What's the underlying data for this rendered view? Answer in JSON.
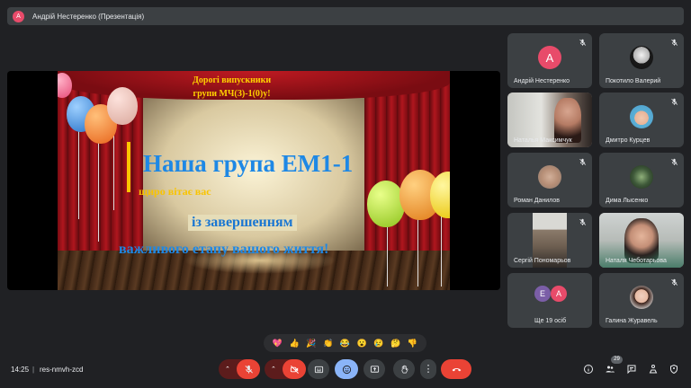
{
  "presenter": {
    "avatar_letter": "А",
    "title": "Андрій Нестеренко (Презентація)"
  },
  "slide": {
    "greeting_line1": "Дорогі випускники",
    "greeting_line2": "групи МЧ(З)-1(0)у!",
    "group_text": "Наша група ЕМ1-1",
    "welcome_text": "щиро вітає вас",
    "congrats_text": "із завершенням",
    "stage_text": "важливого етапу вашого життя!"
  },
  "participants": [
    {
      "name": "Андрій Нестеренко",
      "avatar_letter": "А",
      "avatar_color": "#e84b6a"
    },
    {
      "name": "Покотило Валерий"
    },
    {
      "name": "Наталья Максимчук"
    },
    {
      "name": "Дмитро Курцев"
    },
    {
      "name": "Роман Данилов"
    },
    {
      "name": "Дима Лысенко"
    },
    {
      "name": "Сергій Пономарьов"
    },
    {
      "name": "Наталя Чеботарьова"
    },
    {
      "name": "Ще 19 осіб",
      "avatar_letters": [
        "Е",
        "А"
      ]
    },
    {
      "name": "Галина Журавель"
    }
  ],
  "reactions": [
    "💖",
    "👍",
    "🎉",
    "👏",
    "😂",
    "😮",
    "😢",
    "🤔",
    "👎"
  ],
  "footer": {
    "time": "14:25",
    "separator": "|",
    "meeting_code": "res-nmvh-zcd",
    "participant_count": "29"
  },
  "colors": {
    "background": "#202124",
    "tile": "#3c4043",
    "end_call": "#ea4335",
    "active_control": "#8ab4f8"
  }
}
